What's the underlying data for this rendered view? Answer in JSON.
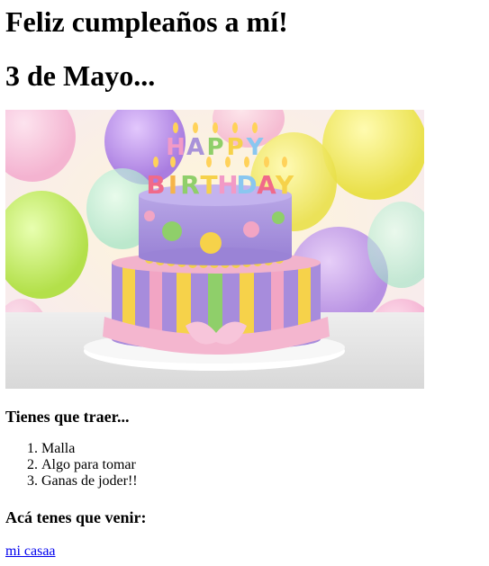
{
  "page": {
    "heading_main": "Feliz cumpleaños a mí!",
    "heading_date": "3 de Mayo..."
  },
  "image": {
    "cake_text": "HAPPY BIRTHDAY"
  },
  "bring_section": {
    "title": "Tienes que traer...",
    "items": [
      "Malla",
      "Algo para tomar",
      "Ganas de joder!!"
    ]
  },
  "location_section": {
    "title": "Acá tenes que venir:",
    "link_text": "mi casaa"
  },
  "colors": {
    "link": "#0000ee",
    "cake_purple": "#a993d9",
    "cake_green": "#8fcf6a",
    "cake_yellow": "#f4d34a",
    "cake_pink": "#f2b3cc"
  }
}
